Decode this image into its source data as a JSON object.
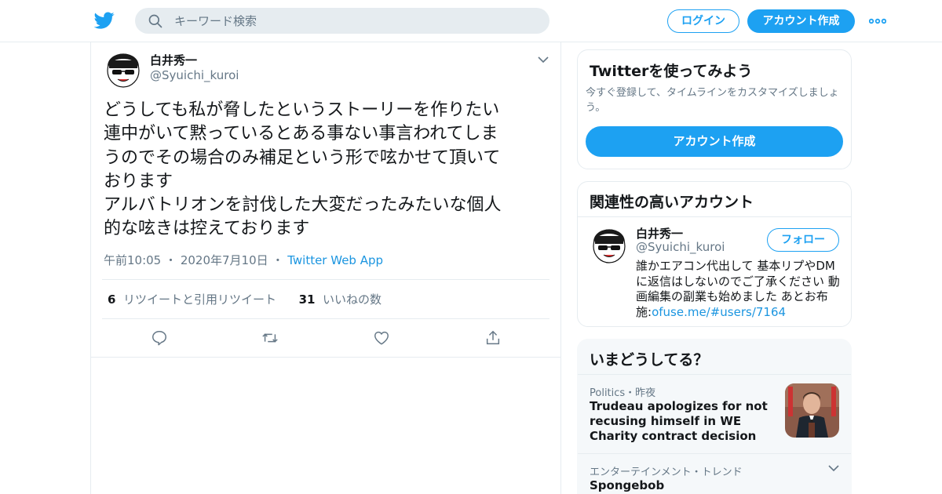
{
  "header": {
    "search_placeholder": "キーワード検索",
    "login_label": "ログイン",
    "signup_label": "アカウント作成"
  },
  "tweet": {
    "author_name": "白井秀一",
    "author_handle": "@Syuichi_kuroi",
    "text": "どうしても私が脅したというストーリーを作りたい\n連中がいて黙っているとある事ない事言われてしま\nうのでその場合のみ補足という形で呟かせて頂いて\nおります\nアルバトリオンを討伐した大変だったみたいな個人\n的な呟きは控えております",
    "time": "午前10:05",
    "date": "2020年7月10日",
    "source": "Twitter Web App",
    "separator": "・",
    "retweet_count": "6",
    "retweet_label": "リツイートと引用リツイート",
    "like_count": "31",
    "like_label": "いいねの数"
  },
  "signup_card": {
    "title": "Twitterを使ってみよう",
    "description": "今すぐ登録して、タイムラインをカスタマイズしましょう。",
    "button_label": "アカウント作成"
  },
  "related_card": {
    "title": "関連性の高いアカウント",
    "name": "白井秀一",
    "handle": "@Syuichi_kuroi",
    "follow_label": "フォロー",
    "bio": "誰かエアコン代出して 基本リプやDMに返信はしないのでご了承ください 動画編集の副業も始めました あとお布施:",
    "bio_link": "ofuse.me/#users/7164"
  },
  "trends_card": {
    "title": "いまどうしてる？",
    "trends": [
      {
        "category": "Politics・昨夜",
        "title": "Trudeau apologizes for not recusing himself in WE Charity contract decision"
      },
      {
        "category": "エンターテインメント・トレンド",
        "title": "Spongebob"
      }
    ]
  },
  "colors": {
    "accent": "#1da1f2",
    "link": "#1b95e0",
    "muted": "#657786",
    "border": "#e6ecf0",
    "text": "#14171a"
  },
  "icons": [
    "twitter-bird-icon",
    "search-icon",
    "more-dots-icon",
    "chevron-down-icon",
    "reply-icon",
    "retweet-icon",
    "like-icon",
    "share-icon"
  ]
}
